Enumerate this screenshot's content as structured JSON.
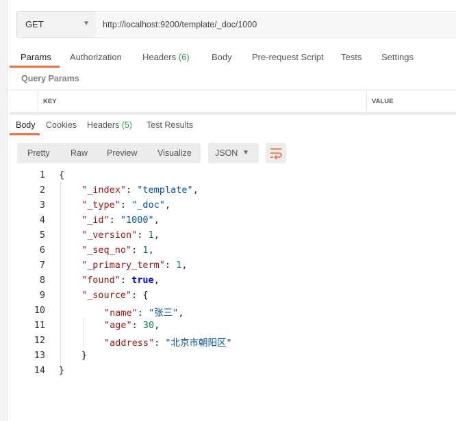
{
  "request": {
    "method": "GET",
    "url": "http://localhost:9200/template/_doc/1000"
  },
  "request_tabs": [
    {
      "label": "Params",
      "count": ""
    },
    {
      "label": "Authorization",
      "count": ""
    },
    {
      "label": "Headers",
      "count": "(6)"
    },
    {
      "label": "Body",
      "count": ""
    },
    {
      "label": "Pre-request Script",
      "count": ""
    },
    {
      "label": "Tests",
      "count": ""
    },
    {
      "label": "Settings",
      "count": ""
    }
  ],
  "query_params": {
    "title": "Query Params",
    "columns": [
      "KEY",
      "VALUE"
    ]
  },
  "response_tabs": [
    {
      "label": "Body",
      "count": ""
    },
    {
      "label": "Cookies",
      "count": ""
    },
    {
      "label": "Headers",
      "count": "(5)"
    },
    {
      "label": "Test Results",
      "count": ""
    }
  ],
  "view_modes": [
    "Pretty",
    "Raw",
    "Preview",
    "Visualize"
  ],
  "format": "JSON",
  "colors": {
    "accent": "#f26b3a",
    "count_green": "#2d9e4a"
  },
  "icons": {
    "method_dropdown": "chevron-down-icon",
    "format_dropdown": "chevron-down-icon",
    "wrap": "wrap-lines-icon"
  },
  "response_body": {
    "line_numbers": [
      "1",
      "2",
      "3",
      "4",
      "5",
      "6",
      "7",
      "8",
      "9",
      "10",
      "11",
      "12",
      "13",
      "14"
    ],
    "lines": [
      {
        "indent": 0,
        "key": "",
        "value": "",
        "type": "",
        "open": "{",
        "comma": ""
      },
      {
        "indent": 1,
        "key": "\"_index\"",
        "value": "\"template\"",
        "type": "str",
        "open": "",
        "comma": ","
      },
      {
        "indent": 1,
        "key": "\"_type\"",
        "value": "\"_doc\"",
        "type": "str",
        "open": "",
        "comma": ","
      },
      {
        "indent": 1,
        "key": "\"_id\"",
        "value": "\"1000\"",
        "type": "str",
        "open": "",
        "comma": ","
      },
      {
        "indent": 1,
        "key": "\"_version\"",
        "value": "1",
        "type": "num",
        "open": "",
        "comma": ","
      },
      {
        "indent": 1,
        "key": "\"_seq_no\"",
        "value": "1",
        "type": "num",
        "open": "",
        "comma": ","
      },
      {
        "indent": 1,
        "key": "\"_primary_term\"",
        "value": "1",
        "type": "num",
        "open": "",
        "comma": ","
      },
      {
        "indent": 1,
        "key": "\"found\"",
        "value": "true",
        "type": "bool",
        "open": "",
        "comma": ","
      },
      {
        "indent": 1,
        "key": "\"_source\"",
        "value": "",
        "type": "",
        "open": "{",
        "comma": ""
      },
      {
        "indent": 2,
        "key": "\"name\"",
        "value": "\"张三\"",
        "type": "str",
        "open": "",
        "comma": ","
      },
      {
        "indent": 2,
        "key": "\"age\"",
        "value": "30",
        "type": "num",
        "open": "",
        "comma": ","
      },
      {
        "indent": 2,
        "key": "\"address\"",
        "value": "\"北京市朝阳区\"",
        "type": "str",
        "open": "",
        "comma": ""
      },
      {
        "indent": 1,
        "key": "",
        "value": "",
        "type": "",
        "open": "}",
        "comma": ""
      },
      {
        "indent": 0,
        "key": "",
        "value": "",
        "type": "",
        "open": "}",
        "comma": ""
      }
    ]
  }
}
